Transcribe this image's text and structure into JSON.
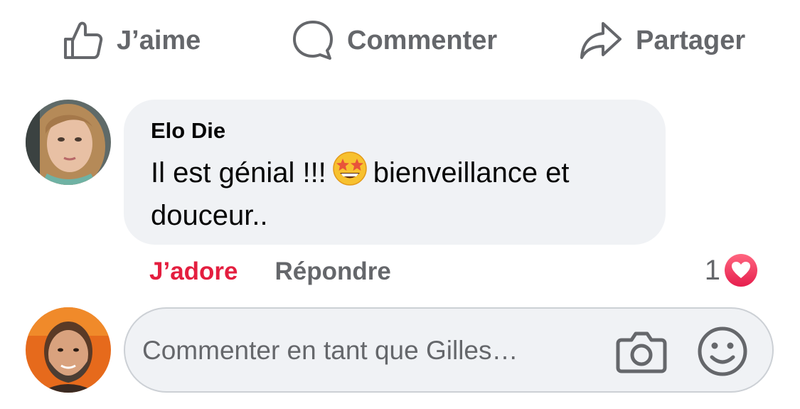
{
  "actions": {
    "like_label": "J’aime",
    "comment_label": "Commenter",
    "share_label": "Partager"
  },
  "comment": {
    "author": "Elo Die",
    "text_part1": "Il est génial !!!",
    "emoji": "star-struck-emoji",
    "text_part2": "bienveillance et douceur..",
    "love_label": "J’adore",
    "reply_label": "Répondre",
    "reaction_count": "1",
    "reaction_type": "love-icon"
  },
  "composer": {
    "placeholder": "Commenter en tant que Gilles…",
    "camera_icon": "camera-icon",
    "emoji_icon": "smiley-icon"
  },
  "colors": {
    "secondary_text": "#65676b",
    "love_red": "#e41e3f",
    "bubble_bg": "#f0f2f5",
    "input_border": "#ccd0d5"
  }
}
